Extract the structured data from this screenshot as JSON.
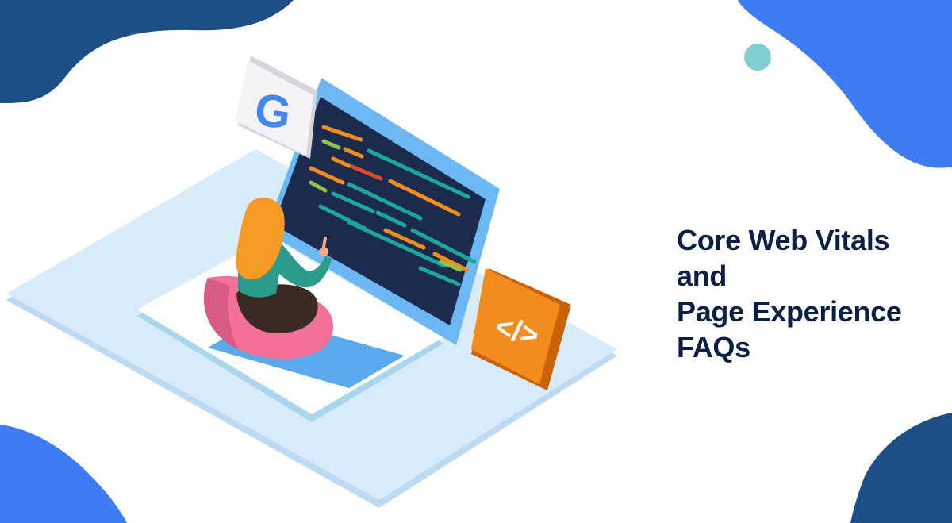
{
  "title": {
    "lines": [
      "Core Web Vitals",
      "and",
      "Page Experience",
      "FAQs"
    ]
  },
  "badges": {
    "google_letter": "G",
    "code_symbol": "</>"
  },
  "colors": {
    "title_text": "#0b1f44",
    "blob_dark": "#1d4f86",
    "blob_blue": "#3d7cf5",
    "dot": "#7fcfd3",
    "platform": "#d7ebfb",
    "platform_edge": "#bcdaf4",
    "screen_frame": "#6bb8f5",
    "screen": "#1c2b4d",
    "keyboard": "#ffffff",
    "touchpad": "#5aa9ea",
    "code_badge": "#f28c1c",
    "code_badge_side": "#c9630b",
    "google_badge": "#f4f4f6",
    "person_hair": "#f59a22",
    "person_shirt": "#2b9c8b",
    "person_pants": "#3a2a22",
    "beanbag": "#f27198"
  }
}
